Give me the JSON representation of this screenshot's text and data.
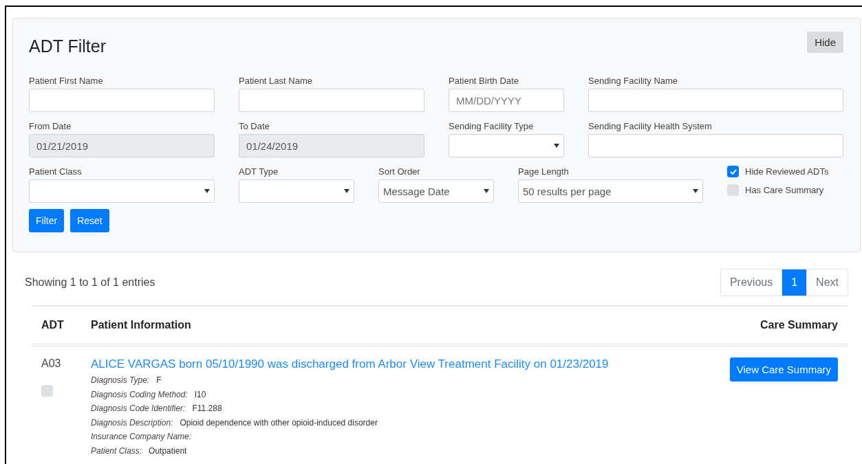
{
  "filter": {
    "title": "ADT Filter",
    "hide_button": "Hide",
    "rows": [
      [
        {
          "kind": "text",
          "label": "Patient First Name",
          "disabled": false
        },
        {
          "kind": "text",
          "label": "Patient Last Name",
          "disabled": false
        },
        {
          "kind": "text",
          "label": "Patient Birth Date",
          "placeholder": "MM/DD/YYYY",
          "disabled": false
        },
        {
          "kind": "text",
          "label": "Sending Facility Name",
          "disabled": false
        }
      ],
      [
        {
          "kind": "text",
          "label": "From Date",
          "value": "01/21/2019",
          "disabled": true
        },
        {
          "kind": "text",
          "label": "To Date",
          "value": "01/24/2019",
          "disabled": true
        },
        {
          "kind": "select",
          "label": "Sending Facility Type",
          "disabled": false
        },
        {
          "kind": "text",
          "label": "Sending Facility Health System",
          "disabled": false
        }
      ],
      [
        {
          "kind": "select",
          "label": "Patient Class",
          "disabled": false
        },
        {
          "kind": "select",
          "label": "ADT Type",
          "disabled": false
        },
        {
          "kind": "select",
          "label": "Sort Order",
          "value": "Message Date",
          "disabled": false
        },
        {
          "kind": "select",
          "label": "Page Length",
          "value": "50 results per page",
          "disabled": false
        },
        {
          "kind": "checks",
          "items": [
            {
              "label": "Hide Reviewed ADTs",
              "checked": true
            },
            {
              "label": "Has Care Summary",
              "checked": false
            }
          ]
        }
      ]
    ],
    "buttons": [
      "Filter",
      "Reset"
    ]
  },
  "results": {
    "summary": "Showing 1 to 1 of 1 entries",
    "pagination": [
      {
        "label": "Previous",
        "selected": false
      },
      {
        "label": "1",
        "selected": true
      },
      {
        "label": "Next",
        "selected": false
      }
    ],
    "columns": [
      "ADT",
      "Patient Information",
      "Care Summary"
    ],
    "rows": [
      {
        "adt": "A03",
        "reviewed": false,
        "headline": "ALICE VARGAS born 05/10/1990 was discharged from Arbor View Treatment Facility on 01/23/2019",
        "details": [
          {
            "label": "Diagnosis Type:",
            "value": "F"
          },
          {
            "label": "Diagnosis Coding Method:",
            "value": "I10"
          },
          {
            "label": "Diagnosis Code Identifier:",
            "value": "F11.288"
          },
          {
            "label": "Diagnosis Description:",
            "value": "Opioid dependence with other opioid-induced disorder"
          },
          {
            "label": "Insurance Company Name:"
          },
          {
            "label": "Patient Class:",
            "value": "Outpatient"
          }
        ],
        "action": "View Care Summary"
      }
    ]
  }
}
